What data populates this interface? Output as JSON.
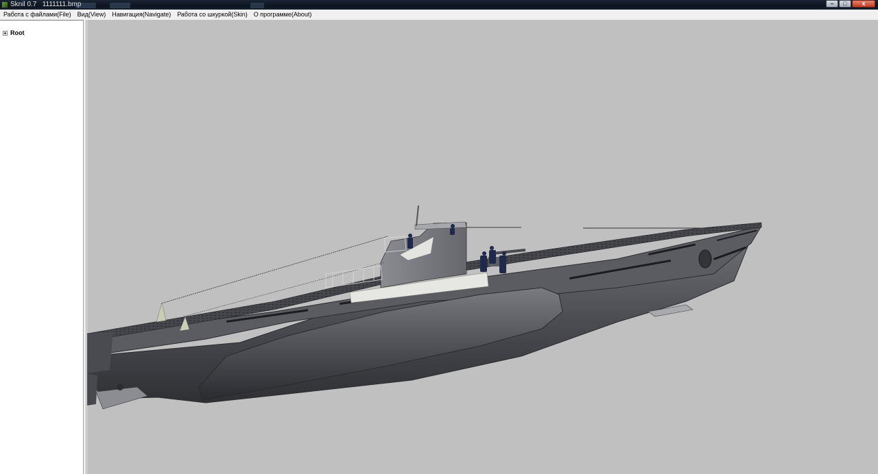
{
  "window": {
    "title": "Sknil 0.7   1111111.bmp",
    "controls": {
      "minimize_glyph": "–",
      "maximize_glyph": "□",
      "close_glyph": "x"
    }
  },
  "menubar": {
    "items": [
      "Работа с файлами(File)",
      "Вид(View)",
      "Навигация(Navigate)",
      "Работа со шкуркой(Skin)",
      "О программе(About)"
    ]
  },
  "tree": {
    "root_label": "Root"
  },
  "viewport": {
    "background": "#c0c0c0",
    "model": "submarine"
  },
  "colors": {
    "hull_dark": "#3e3f44",
    "hull_mid": "#5a5b60",
    "deck": "#4b4c52",
    "tower": "#7c7d82",
    "panel_light": "#e6e6e2"
  }
}
